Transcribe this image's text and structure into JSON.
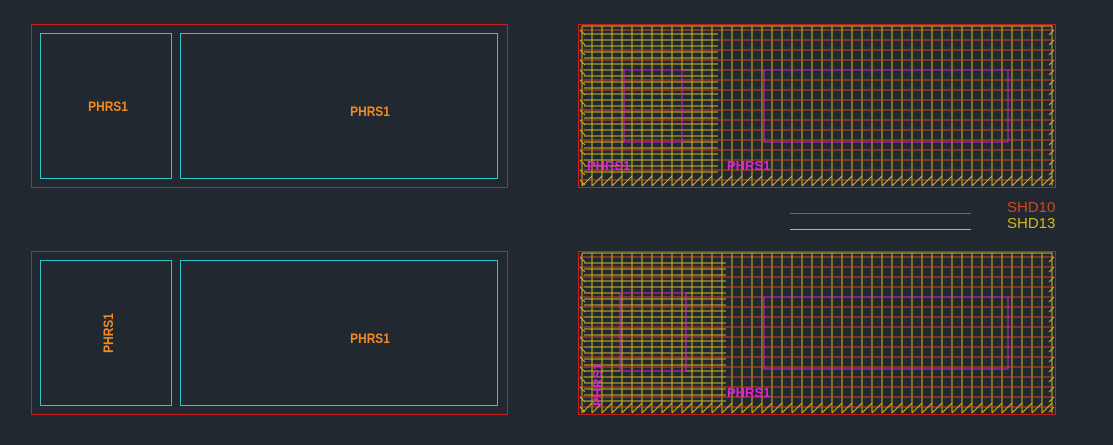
{
  "colors": {
    "background": "#212830",
    "frame": "#c81e1e",
    "cell": "#2ec8cc",
    "label": "#f08a24",
    "hatch_yellow": "#d4b820",
    "hatch_red": "#d2451e",
    "magenta": "#e020d8"
  },
  "panel_top_left": {
    "label_a": "PHRS1",
    "label_b": "PHRS1"
  },
  "panel_bottom_left": {
    "label_a": "PHRS1",
    "label_b": "PHRS1"
  },
  "panel_top_right": {
    "label_a": "PHRS1",
    "label_b": "PHRS1"
  },
  "panel_bottom_right": {
    "label_a": "PHRS1",
    "label_b": "PHRS1"
  },
  "legend": {
    "shd10": {
      "text": "SHD10",
      "color": "#d2451e"
    },
    "shd13": {
      "text": "SHD13",
      "color": "#d4b820"
    }
  }
}
